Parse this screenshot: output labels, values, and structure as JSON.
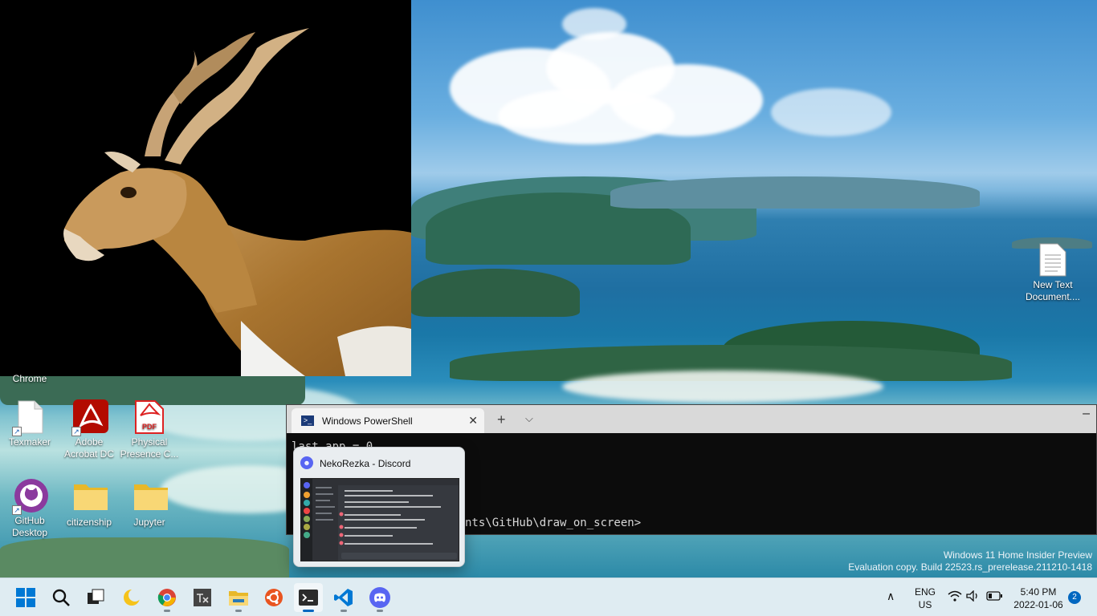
{
  "photo": {
    "description_icon": "antelope-photo"
  },
  "desktop_icons": [
    {
      "id": "chrome",
      "label": "Chrome",
      "icon": "chrome-icon"
    },
    {
      "id": "texmaker",
      "label": "Texmaker",
      "icon": "document-icon"
    },
    {
      "id": "acrobat",
      "label": "Adobe Acrobat DC",
      "icon": "acrobat-icon"
    },
    {
      "id": "physical",
      "label": "Physical Presence C...",
      "icon": "pdf-icon"
    },
    {
      "id": "github",
      "label": "GitHub Desktop",
      "icon": "github-icon"
    },
    {
      "id": "citizenship",
      "label": "citizenship",
      "icon": "folder-icon"
    },
    {
      "id": "jupyter",
      "label": "Jupyter",
      "icon": "folder-icon"
    },
    {
      "id": "newtext",
      "label": "New Text Document....",
      "icon": "text-file-icon"
    }
  ],
  "powershell": {
    "tab_title": "Windows PowerShell",
    "line1": "last_app = 0",
    "line2": "nts\\GitHub\\draw_on_screen>",
    "pdf_badge": "PDF"
  },
  "preview": {
    "title": "NekoRezka - Discord"
  },
  "watermark": {
    "line1": "Windows 11 Home Insider Preview",
    "line2": "Evaluation copy. Build 22523.rs_prerelease.211210-1418"
  },
  "taskbar": {
    "apps": [
      "start-icon",
      "search-icon",
      "task-view-icon",
      "widgets-icon",
      "chrome-icon",
      "texmaker-icon",
      "file-explorer-icon",
      "ubuntu-icon",
      "terminal-icon",
      "vscode-icon",
      "discord-icon"
    ],
    "lang_top": "ENG",
    "lang_bottom": "US",
    "time": "5:40 PM",
    "date": "2022-01-06",
    "notification_count": "2",
    "overflow_glyph": "∧"
  },
  "colors": {
    "accent": "#0067c0",
    "discord": "#5865f2",
    "acrobat": "#b30b00"
  }
}
